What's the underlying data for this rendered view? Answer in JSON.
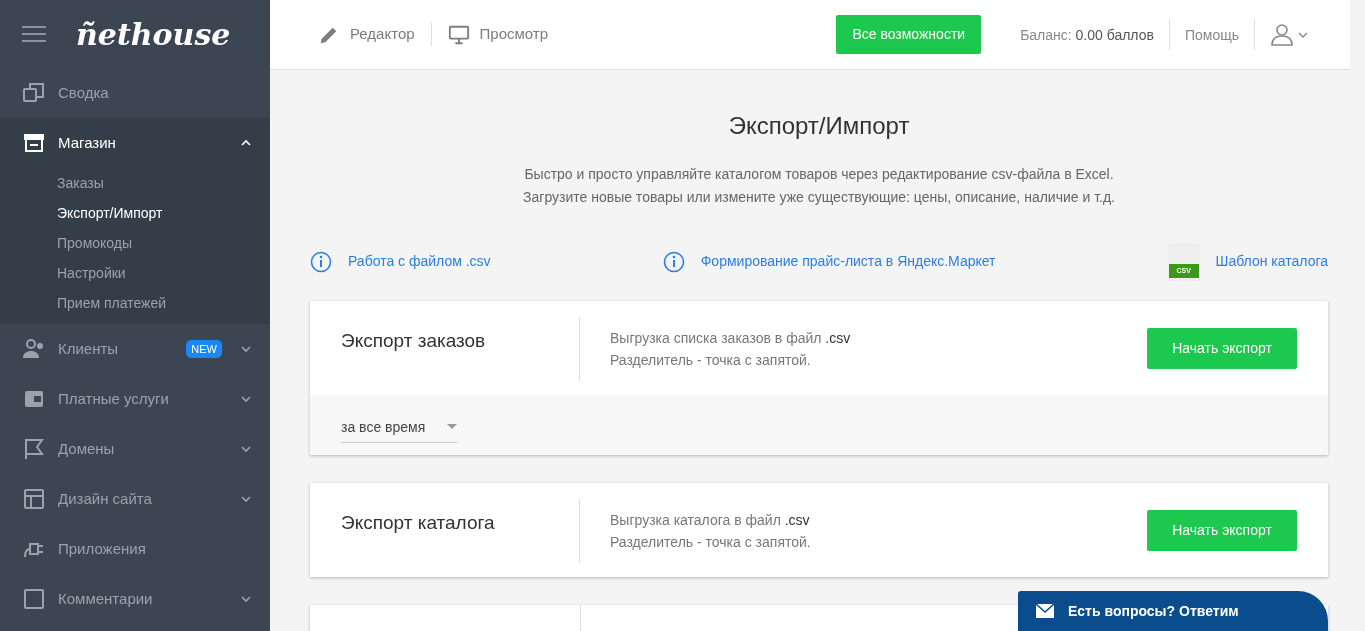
{
  "sidebar": {
    "logo": "ñethouse",
    "items": [
      {
        "label": "Сводка",
        "expandable": false,
        "expanded": false
      },
      {
        "label": "Магазин",
        "expandable": true,
        "expanded": true,
        "children": [
          {
            "label": "Заказы",
            "selected": false
          },
          {
            "label": "Экспорт/Импорт",
            "selected": true
          },
          {
            "label": "Промокоды",
            "selected": false
          },
          {
            "label": "Настройки",
            "selected": false
          },
          {
            "label": "Прием платежей",
            "selected": false
          }
        ]
      },
      {
        "label": "Клиенты",
        "badge": "NEW",
        "expandable": true,
        "expanded": false
      },
      {
        "label": "Платные услуги",
        "expandable": true,
        "expanded": false
      },
      {
        "label": "Домены",
        "expandable": true,
        "expanded": false
      },
      {
        "label": "Дизайн сайта",
        "expandable": true,
        "expanded": false
      },
      {
        "label": "Приложения",
        "expandable": false,
        "expanded": false
      },
      {
        "label": "Комментарии",
        "expandable": true,
        "expanded": false
      }
    ]
  },
  "topbar": {
    "modes": [
      {
        "label": "Редактор"
      },
      {
        "label": "Просмотр"
      }
    ],
    "cta": "Все возможности",
    "balance_label": "Баланс:",
    "balance_value": "0.00 баллов",
    "help": "Помощь"
  },
  "page": {
    "title": "Экспорт/Импорт",
    "intro": [
      "Быстро и просто управляйте каталогом товаров через редактирование csv-файла в Excel.",
      "Загрузите новые товары или измените уже существующие: цены, описание, наличие и т.д."
    ],
    "links": [
      {
        "label": "Работа с файлом .csv",
        "kind": "info"
      },
      {
        "label": "Формирование прайс-листа в Яндекс.Маркет",
        "kind": "info"
      },
      {
        "label": "Шаблон каталога",
        "kind": "file",
        "file_badge": "CSV"
      }
    ],
    "cards": [
      {
        "title": "Экспорт заказов",
        "line1": "Выгрузка списка заказов в файл",
        "ext": ".csv",
        "line2": "Разделитель - точка с запятой.",
        "button": "Начать экспорт",
        "period": "за все время"
      },
      {
        "title": "Экспорт каталога",
        "line1": "Выгрузка каталога в файл",
        "ext": ".csv",
        "line2": "Разделитель - точка с запятой.",
        "button": "Начать экспорт"
      }
    ]
  },
  "chat": {
    "label": "Есть вопросы? Ответим"
  }
}
